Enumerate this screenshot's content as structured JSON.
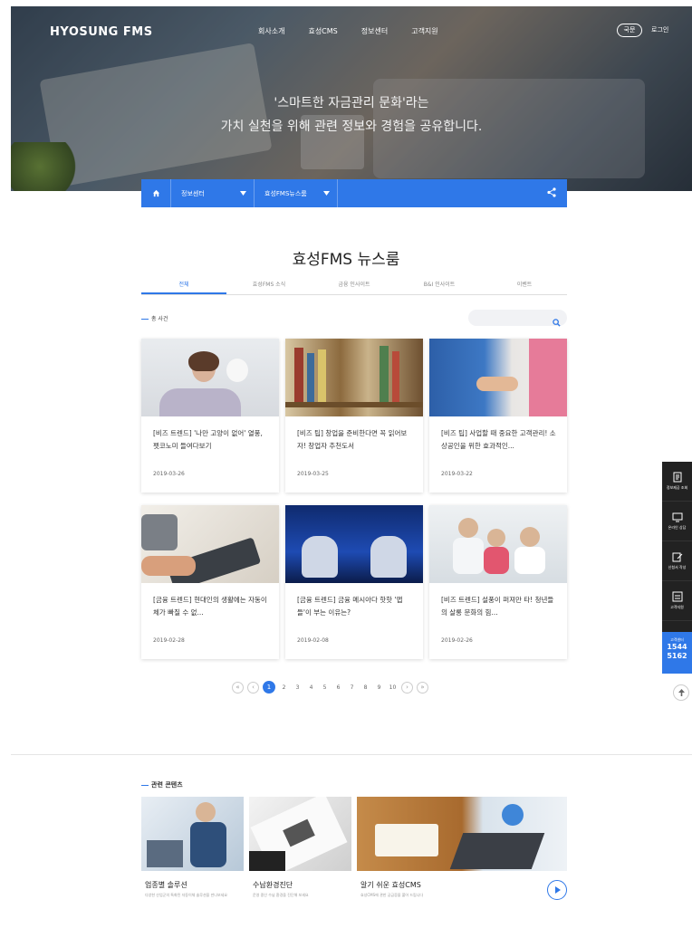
{
  "header": {
    "logo": "HYOSUNG FMS",
    "nav": [
      "회사소개",
      "효성CMS",
      "정보센터",
      "고객지원"
    ],
    "lang": "국문",
    "login": "로그인"
  },
  "hero": {
    "line1": "'스마트한 자금관리 문화'라는",
    "line2": "가치 실천을 위해 관련 정보와 경험을 공유합니다."
  },
  "breadcrumb": {
    "level1": "정보센터",
    "level2": "효성FMS뉴스룸"
  },
  "page_title": "효성FMS 뉴스룸",
  "tabs": [
    "전체",
    "효성FMS 소식",
    "금융 인사이트",
    "B&I 인사이트",
    "이벤트"
  ],
  "list": {
    "total_label": "총 사건",
    "search_placeholder": ""
  },
  "cards": [
    {
      "title": "[비즈 트렌드] '나만 고양이 없어' 열풍, 펫코노미 들여다보기",
      "date": "2019-03-26"
    },
    {
      "title": "[비즈 팁] 창업을 준비한다면 꼭 읽어보자! 창업자 추천도서",
      "date": "2019-03-25"
    },
    {
      "title": "[비즈 팁] 사업할 때 중요한 고객관리! 소상공인을 위한 효과적인...",
      "date": "2019-03-22"
    },
    {
      "title": "[금융 트렌드] 현대인의 생활에는 자동이체가 빠질 수 없...",
      "date": "2019-02-28"
    },
    {
      "title": "[금융 트렌드] 금융 메시아다 핫핫 '앱들'이 부는 이유는?",
      "date": "2019-02-08"
    },
    {
      "title": "[비즈 트렌드] 설풍이 퍼져만 타! 청년들의 살롱 문화의 힘...",
      "date": "2019-02-26"
    }
  ],
  "pagination": {
    "pages": [
      "1",
      "2",
      "3",
      "4",
      "5",
      "6",
      "7",
      "8",
      "9",
      "10"
    ],
    "current": "1"
  },
  "quick_menu": {
    "items": [
      "정보제공 조회",
      "온라인 상담",
      "신청서 작성",
      "고객지원"
    ],
    "call_label": "고객센터",
    "call_number_1": "1544",
    "call_number_2": "5162"
  },
  "related": {
    "title": "관련 콘텐츠",
    "items": [
      {
        "title": "업종별 솔루션",
        "desc": "다양한 산업군의 특화된 자동이체 솔루션을 만나보세요"
      },
      {
        "title": "수납환경진단",
        "desc": "운영 중인 수납 환경을 진단해 보세요"
      },
      {
        "title": "알기 쉬운 효성CMS",
        "desc": "효성CMS에 관한 궁금증을 풀어 드립니다"
      }
    ]
  },
  "colors": {
    "accent": "#2f78e8",
    "dark": "#222222"
  }
}
